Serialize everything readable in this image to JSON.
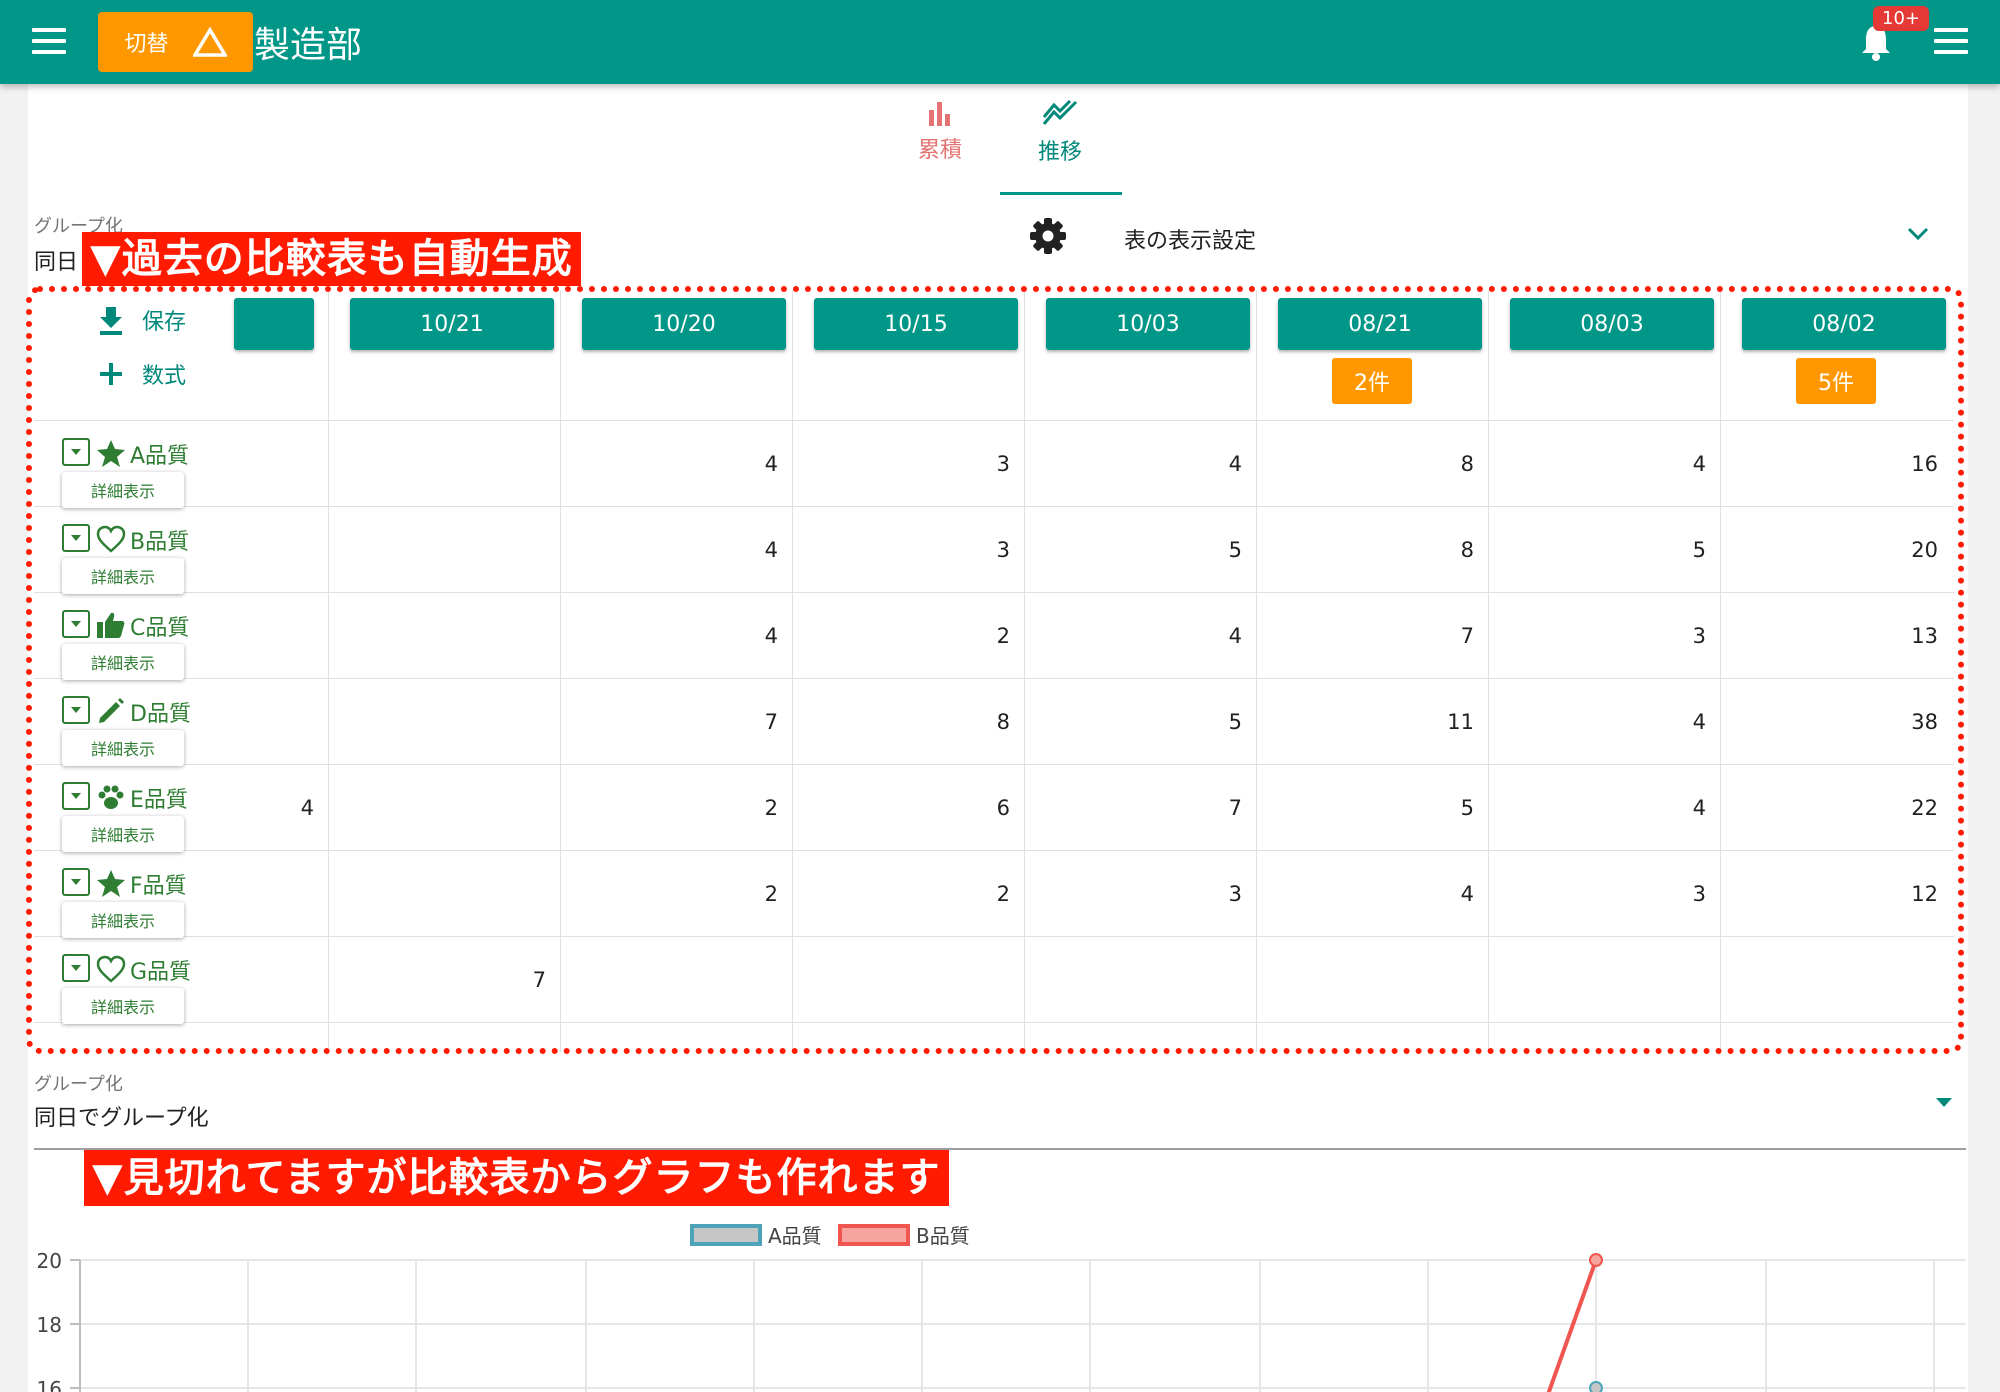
{
  "appbar": {
    "switch_label": "切替",
    "department": "製造部",
    "notification_badge": "10+"
  },
  "tabs": [
    {
      "label": "累積",
      "icon": "bar-chart-icon"
    },
    {
      "label": "推移",
      "icon": "trend-line-icon"
    }
  ],
  "grouping_top": {
    "label": "グループ化",
    "value": "同日"
  },
  "table_settings": {
    "label": "表の表示設定"
  },
  "annotations": {
    "table": "▼過去の比較表も自動生成",
    "chart": "▼見切れてますが比較表からグラフも作れます"
  },
  "toolbar": {
    "save": "保存",
    "formula": "数式"
  },
  "table": {
    "dates": [
      "10/21",
      "10/20",
      "10/15",
      "10/03",
      "08/21",
      "08/03",
      "08/02"
    ],
    "counts": [
      "",
      "",
      "",
      "",
      "2件",
      "",
      "5件"
    ],
    "detail_label": "詳細表示",
    "rows": [
      {
        "name": "A品質",
        "icon": "star-icon",
        "values": [
          "",
          "",
          "4",
          "3",
          "4",
          "8",
          "4",
          "16"
        ]
      },
      {
        "name": "B品質",
        "icon": "heart-icon",
        "values": [
          "",
          "",
          "4",
          "3",
          "5",
          "8",
          "5",
          "20"
        ]
      },
      {
        "name": "C品質",
        "icon": "thumbs-up-icon",
        "values": [
          "",
          "",
          "4",
          "2",
          "4",
          "7",
          "3",
          "13"
        ]
      },
      {
        "name": "D品質",
        "icon": "pencil-icon",
        "values": [
          "",
          "",
          "7",
          "8",
          "5",
          "11",
          "4",
          "38"
        ]
      },
      {
        "name": "E品質",
        "icon": "paw-icon",
        "values": [
          "4",
          "",
          "2",
          "6",
          "7",
          "5",
          "4",
          "22"
        ]
      },
      {
        "name": "F品質",
        "icon": "star-icon",
        "values": [
          "",
          "",
          "2",
          "2",
          "3",
          "4",
          "3",
          "12"
        ]
      },
      {
        "name": "G品質",
        "icon": "heart-icon",
        "values": [
          "",
          "7",
          "",
          "",
          "",
          "",
          "",
          ""
        ]
      }
    ]
  },
  "grouping_bottom": {
    "label": "グループ化",
    "value": "同日でグループ化"
  },
  "colors": {
    "primary": "#009688",
    "accent": "#ff9800",
    "annotation": "#ff1a00"
  },
  "chart_data": {
    "type": "line",
    "legend": [
      "A品質",
      "B品質"
    ],
    "y_ticks": [
      "20",
      "18",
      "16"
    ],
    "ylim": [
      16,
      20
    ],
    "series": [
      {
        "name": "A品質",
        "color": "#4fa3b8",
        "values": [
          16
        ]
      },
      {
        "name": "B品質",
        "color": "#f0564f",
        "values": [
          20
        ]
      }
    ]
  }
}
